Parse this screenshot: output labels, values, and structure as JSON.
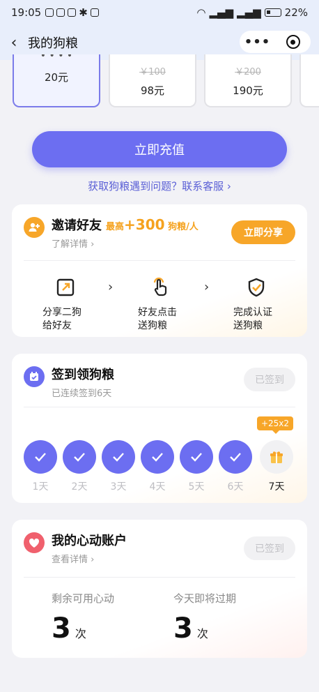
{
  "status_bar": {
    "time": "19:05",
    "battery": "22%"
  },
  "nav": {
    "title": "我的狗粮",
    "more": "•••"
  },
  "packages": [
    {
      "old_price": "",
      "price": "20元",
      "selected": true
    },
    {
      "old_price": "￥100",
      "price": "98元",
      "selected": false
    },
    {
      "old_price": "￥200",
      "price": "190元",
      "selected": false
    }
  ],
  "recharge_button": "立即充值",
  "help_link": "获取狗粮遇到问题？联系客服 ›",
  "invite": {
    "title": "邀请好友",
    "bonus_prefix": "最高",
    "bonus_value": "+300",
    "bonus_unit": "狗粮/人",
    "details": "了解详情 ›",
    "share_button": "立即分享",
    "steps": [
      {
        "line1": "分享二狗",
        "line2": "给好友",
        "icon": "share-icon"
      },
      {
        "line1": "好友点击",
        "line2": "送狗粮",
        "icon": "tap-icon"
      },
      {
        "line1": "完成认证",
        "line2": "送狗粮",
        "icon": "verified-shield-icon"
      }
    ],
    "arrow": "›"
  },
  "signin": {
    "title": "签到领狗粮",
    "subtitle": "已连续签到6天",
    "button": "已签到",
    "days": [
      "1天",
      "2天",
      "3天",
      "4天",
      "5天",
      "6天",
      "7天"
    ],
    "checked_days": 6,
    "gift_badge": "+25x2"
  },
  "heart": {
    "title": "我的心动账户",
    "details": "查看详情 ›",
    "button": "已签到",
    "remaining_label": "剩余可用心动",
    "remaining_value": "3",
    "expiring_label": "今天即将过期",
    "expiring_value": "3",
    "unit": "次"
  },
  "colors": {
    "primary": "#6c6ef1",
    "orange": "#f7a629",
    "pink": "#f0606d"
  }
}
